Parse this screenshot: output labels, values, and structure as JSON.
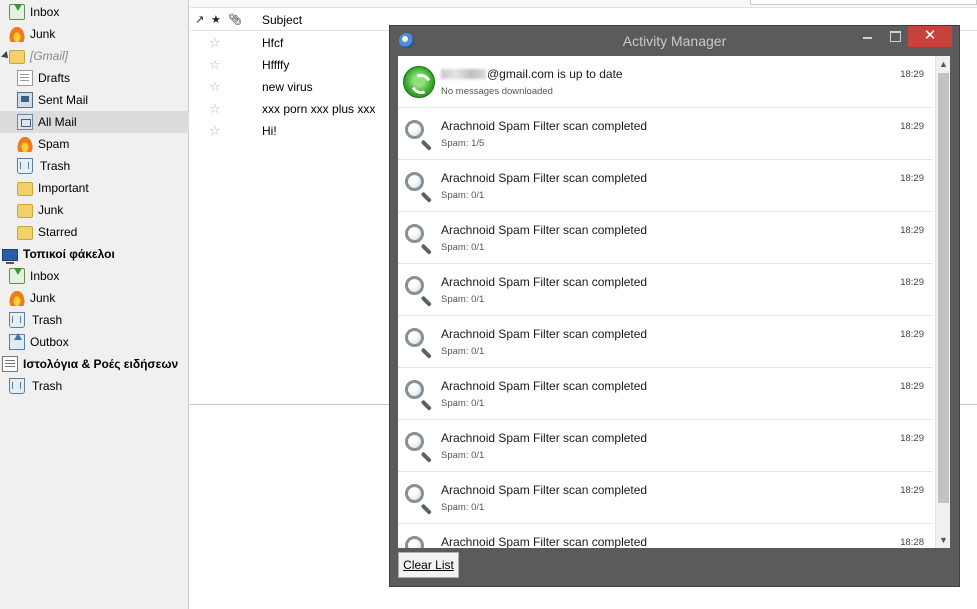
{
  "folders": [
    {
      "label": "Inbox",
      "icon": "inbox-icon",
      "style": "normal"
    },
    {
      "label": "Junk",
      "icon": "flame-icon",
      "style": "normal"
    },
    {
      "label": "[Gmail]",
      "icon": "folder-icon",
      "style": "italic"
    },
    {
      "label": "Drafts",
      "icon": "drafts-icon",
      "style": "normal"
    },
    {
      "label": "Sent Mail",
      "icon": "sent-icon",
      "style": "normal"
    },
    {
      "label": "All Mail",
      "icon": "all-mail-icon",
      "style": "normal",
      "selected": true
    },
    {
      "label": "Spam",
      "icon": "flame-icon",
      "style": "normal"
    },
    {
      "label": "Trash",
      "icon": "trash-icon",
      "style": "normal"
    },
    {
      "label": "Important",
      "icon": "folder-icon",
      "style": "normal"
    },
    {
      "label": "Junk",
      "icon": "folder-icon",
      "style": "normal"
    },
    {
      "label": "Starred",
      "icon": "folder-icon",
      "style": "normal"
    },
    {
      "label": "Τοπικοί φάκελοι",
      "icon": "computer-icon",
      "style": "bold"
    },
    {
      "label": "Inbox",
      "icon": "inbox-icon",
      "style": "normal"
    },
    {
      "label": "Junk",
      "icon": "flame-icon",
      "style": "normal"
    },
    {
      "label": "Trash",
      "icon": "trash-icon",
      "style": "normal"
    },
    {
      "label": "Outbox",
      "icon": "outbox-icon",
      "style": "normal"
    },
    {
      "label": "Ιστολόγια & Ροές ειδήσεων",
      "icon": "news-icon",
      "style": "bold"
    },
    {
      "label": "Trash",
      "icon": "trash-icon",
      "style": "normal"
    }
  ],
  "message_list": {
    "header": {
      "subject_label": "Subject"
    },
    "messages": [
      {
        "subject": "Hfcf"
      },
      {
        "subject": "Hffffy"
      },
      {
        "subject": "new virus"
      },
      {
        "subject": "xxx porn xxx plus xxx"
      },
      {
        "subject": "Hi!"
      }
    ]
  },
  "activity_manager": {
    "title": "Activity Manager",
    "close_glyph": "✕",
    "items": [
      {
        "icon": "sync-icon",
        "title_suffix": "@gmail.com is up to date",
        "detail": "No messages downloaded",
        "time": "18:29",
        "redacted_name": true
      },
      {
        "icon": "magnifier-icon",
        "title": "Arachnoid Spam Filter scan completed",
        "detail": "Spam: 1/5",
        "time": "18:29"
      },
      {
        "icon": "magnifier-icon",
        "title": "Arachnoid Spam Filter scan completed",
        "detail": "Spam: 0/1",
        "time": "18:29"
      },
      {
        "icon": "magnifier-icon",
        "title": "Arachnoid Spam Filter scan completed",
        "detail": "Spam: 0/1",
        "time": "18:29"
      },
      {
        "icon": "magnifier-icon",
        "title": "Arachnoid Spam Filter scan completed",
        "detail": "Spam: 0/1",
        "time": "18:29"
      },
      {
        "icon": "magnifier-icon",
        "title": "Arachnoid Spam Filter scan completed",
        "detail": "Spam: 0/1",
        "time": "18:29"
      },
      {
        "icon": "magnifier-icon",
        "title": "Arachnoid Spam Filter scan completed",
        "detail": "Spam: 0/1",
        "time": "18:29"
      },
      {
        "icon": "magnifier-icon",
        "title": "Arachnoid Spam Filter scan completed",
        "detail": "Spam: 0/1",
        "time": "18:29"
      },
      {
        "icon": "magnifier-icon",
        "title": "Arachnoid Spam Filter scan completed",
        "detail": "Spam: 0/1",
        "time": "18:29"
      },
      {
        "icon": "magnifier-icon",
        "title": "Arachnoid Spam Filter scan completed",
        "detail": "",
        "time": "18:28"
      }
    ],
    "clear_button_label": "Clear List"
  },
  "colors": {
    "window_frame": "#5b5b5b",
    "close_button": "#c7423d",
    "selected_folder": "#dcdcdc"
  }
}
